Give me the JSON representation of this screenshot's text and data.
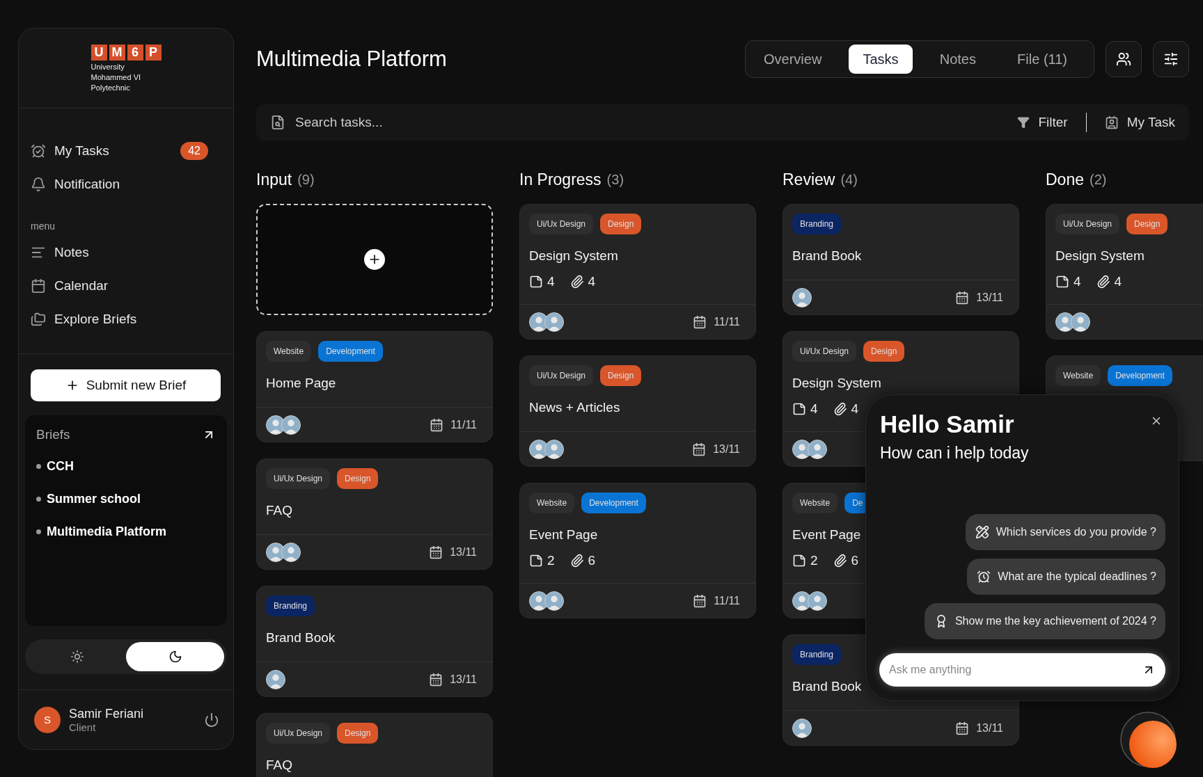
{
  "sidebar": {
    "logo": {
      "letters": [
        "U",
        "M",
        "6",
        "P"
      ],
      "lines": [
        "University",
        "Mohammed VI",
        "Polytechnic"
      ]
    },
    "top_items": [
      {
        "label": "My Tasks",
        "badge": "42"
      },
      {
        "label": "Notification"
      }
    ],
    "menu_label": "menu",
    "menu_items": [
      {
        "label": "Notes"
      },
      {
        "label": "Calendar"
      },
      {
        "label": "Explore Briefs"
      }
    ],
    "submit_button": "Submit new Brief",
    "briefs": {
      "title": "Briefs",
      "items": [
        "CCH",
        "Summer school",
        "Multimedia Platform"
      ]
    },
    "theme_toggle": [
      {
        "selected": false
      },
      {
        "selected": true
      }
    ],
    "user": {
      "initial": "S",
      "name": "Samir Feriani",
      "role": "Client"
    }
  },
  "header": {
    "title": "Multimedia Platform",
    "tabs": [
      {
        "label": "Overview",
        "selected": false
      },
      {
        "label": "Tasks",
        "selected": true
      },
      {
        "label": "Notes",
        "selected": false
      },
      {
        "label": "File (11)",
        "selected": false
      }
    ]
  },
  "search": {
    "placeholder": "Search tasks...",
    "filter": "Filter",
    "my_task": "My Task"
  },
  "columns": [
    {
      "title": "Input",
      "count": "(9)",
      "add_card": true,
      "cards": [
        {
          "tags": [
            {
              "label": "Website",
              "color": "#2e2e2e"
            },
            {
              "label": "Development",
              "color": "#0a74d4"
            }
          ],
          "title": "Home Page",
          "avatars": [
            {
              "kind": "photo"
            },
            {
              "kind": "photo"
            }
          ],
          "date": "11/11"
        },
        {
          "tags": [
            {
              "label": "Ui/Ux Design",
              "color": "#2e2e2e"
            },
            {
              "label": "Design",
              "color": "#d9562a"
            }
          ],
          "title": "FAQ",
          "avatars": [
            {
              "kind": "photo"
            },
            {
              "kind": "photo"
            }
          ],
          "date": "13/11"
        },
        {
          "tags": [
            {
              "label": "Branding",
              "color": "#0b2563"
            }
          ],
          "title": "Brand Book",
          "avatars": [
            {
              "kind": "photo"
            }
          ],
          "date": "13/11"
        },
        {
          "tags": [
            {
              "label": "Ui/Ux Design",
              "color": "#2e2e2e"
            },
            {
              "label": "Design",
              "color": "#d9562a"
            }
          ],
          "title": "FAQ"
        }
      ]
    },
    {
      "title": "In Progress",
      "count": "(3)",
      "cards": [
        {
          "tags": [
            {
              "label": "Ui/Ux Design",
              "color": "#2e2e2e"
            },
            {
              "label": "Design",
              "color": "#d9562a"
            }
          ],
          "title": "Design System",
          "notes": "4",
          "attachments": "4",
          "avatars": [
            {
              "kind": "photo"
            },
            {
              "kind": "photo"
            }
          ],
          "date": "11/11"
        },
        {
          "tags": [
            {
              "label": "Ui/Ux Design",
              "color": "#2e2e2e"
            },
            {
              "label": "Design",
              "color": "#d9562a"
            }
          ],
          "title": "News + Articles",
          "avatars": [
            {
              "kind": "photo"
            },
            {
              "kind": "photo"
            }
          ],
          "date": "13/11"
        },
        {
          "tags": [
            {
              "label": "Website",
              "color": "#2e2e2e"
            },
            {
              "label": "Development",
              "color": "#0a74d4"
            }
          ],
          "title": "Event Page",
          "notes": "2",
          "attachments": "6",
          "avatars": [
            {
              "kind": "photo"
            },
            {
              "kind": "photo"
            }
          ],
          "date": "11/11"
        }
      ]
    },
    {
      "title": "Review",
      "count": "(4)",
      "cards": [
        {
          "tags": [
            {
              "label": "Branding",
              "color": "#0b2563"
            }
          ],
          "title": "Brand Book",
          "avatars": [
            {
              "kind": "photo"
            }
          ],
          "date": "13/11"
        },
        {
          "tags": [
            {
              "label": "Ui/Ux Design",
              "color": "#2e2e2e"
            },
            {
              "label": "Design",
              "color": "#d9562a"
            }
          ],
          "title": "Design System",
          "notes": "4",
          "attachments": "4",
          "avatars": [
            {
              "kind": "photo"
            },
            {
              "kind": "photo"
            }
          ]
        },
        {
          "tags": [
            {
              "label": "Website",
              "color": "#2e2e2e"
            },
            {
              "label": "De",
              "color": "#0a74d4"
            }
          ],
          "title": "Event Page",
          "notes": "2",
          "attachments": "6",
          "avatars": [
            {
              "kind": "photo"
            },
            {
              "kind": "photo"
            }
          ]
        },
        {
          "tags": [
            {
              "label": "Branding",
              "color": "#0b2563"
            }
          ],
          "title": "Brand Book",
          "avatars": [
            {
              "kind": "photo"
            }
          ],
          "date": "13/11"
        }
      ]
    },
    {
      "title": "Done",
      "count": "(2)",
      "cards": [
        {
          "tags": [
            {
              "label": "Ui/Ux Design",
              "color": "#2e2e2e"
            },
            {
              "label": "Design",
              "color": "#d9562a"
            }
          ],
          "title": "Design System",
          "notes": "4",
          "attachments": "4",
          "avatars": [
            {
              "kind": "photo"
            },
            {
              "kind": "photo"
            }
          ]
        },
        {
          "tags": [
            {
              "label": "Website",
              "color": "#2e2e2e"
            },
            {
              "label": "Development",
              "color": "#0a74d4"
            }
          ]
        }
      ]
    }
  ],
  "assistant": {
    "title": "Hello Samir",
    "subtitle": "How can i help today",
    "suggestions": [
      "Which services do you provide ?",
      "What are the typical deadlines ?",
      "Show me the key achievement of 2024 ?"
    ],
    "placeholder": "Ask me anything"
  }
}
